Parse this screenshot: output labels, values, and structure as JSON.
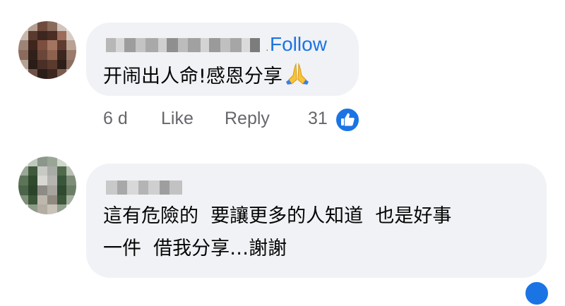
{
  "comments": [
    {
      "follow_label": "Follow",
      "separator": "·",
      "text": "开闹出人命!感恩分享",
      "emoji": "folded-hands-icon",
      "time": "6 d",
      "like_label": "Like",
      "reply_label": "Reply",
      "reaction_count": "31",
      "reaction_icon": "like-reaction-icon"
    },
    {
      "text_line1": "這有危險的  要讓更多的人知道  也是好事",
      "text_line2": "一件  借我分享…謝謝"
    }
  ],
  "colors": {
    "bubble": "#f0f2f5",
    "link": "#1b74e4",
    "meta": "#65676b",
    "text": "#050505"
  }
}
